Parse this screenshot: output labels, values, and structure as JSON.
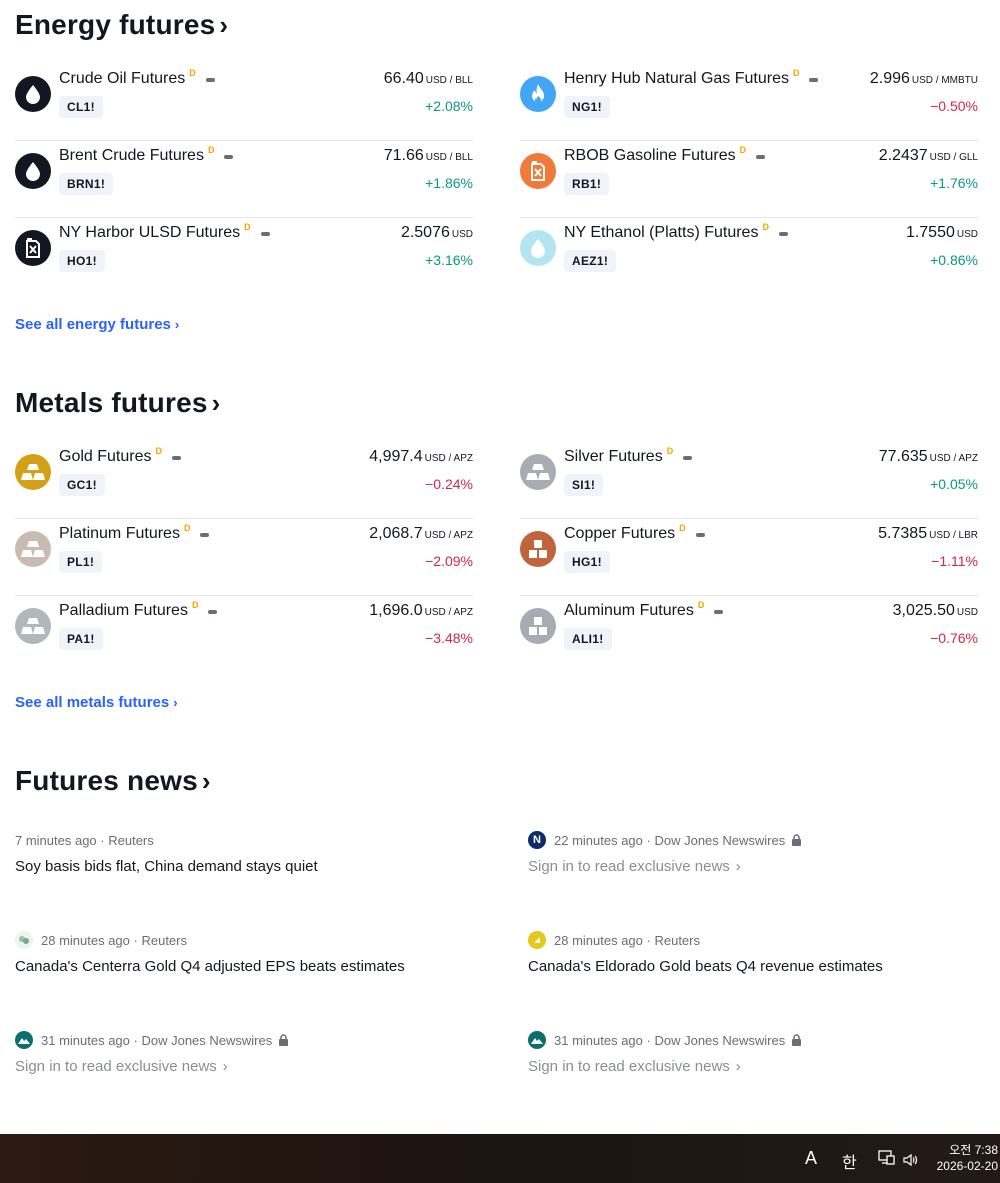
{
  "energy": {
    "title": "Energy futures",
    "see_all": "See all energy futures",
    "items": [
      {
        "name": "Crude Oil Futures",
        "d": "D",
        "ticker": "CL1!",
        "price": "66.40",
        "unit": "USD / BLL",
        "change": "+2.08%",
        "dir": "up",
        "icon": "oil-drop-icon",
        "color": "#131722"
      },
      {
        "name": "Henry Hub Natural Gas Futures",
        "d": "D",
        "ticker": "NG1!",
        "price": "2.996",
        "unit": "USD / MMBTU",
        "change": "−0.50%",
        "dir": "down",
        "icon": "flame-icon",
        "color": "#42a5f5"
      },
      {
        "name": "Brent Crude Futures",
        "d": "D",
        "ticker": "BRN1!",
        "price": "71.66",
        "unit": "USD / BLL",
        "change": "+1.86%",
        "dir": "up",
        "icon": "oil-drop-icon",
        "color": "#131722"
      },
      {
        "name": "RBOB Gasoline Futures",
        "d": "D",
        "ticker": "RB1!",
        "price": "2.2437",
        "unit": "USD / GLL",
        "change": "+1.76%",
        "dir": "up",
        "icon": "fuel-can-icon",
        "color": "#f07a3a"
      },
      {
        "name": "NY Harbor ULSD Futures",
        "d": "D",
        "ticker": "HO1!",
        "price": "2.5076",
        "unit": "USD",
        "change": "+3.16%",
        "dir": "up",
        "icon": "fuel-can-icon",
        "color": "#131722"
      },
      {
        "name": "NY Ethanol (Platts) Futures",
        "d": "D",
        "ticker": "AEZ1!",
        "price": "1.7550",
        "unit": "USD",
        "change": "+0.86%",
        "dir": "up",
        "icon": "water-drop-icon",
        "color": "#b3e5f0"
      }
    ]
  },
  "metals": {
    "title": "Metals futures",
    "see_all": "See all metals futures",
    "items": [
      {
        "name": "Gold Futures",
        "d": "D",
        "ticker": "GC1!",
        "price": "4,997.4",
        "unit": "USD / APZ",
        "change": "−0.24%",
        "dir": "down",
        "icon": "gold-bars-icon",
        "color": "#d4a017"
      },
      {
        "name": "Silver Futures",
        "d": "D",
        "ticker": "SI1!",
        "price": "77.635",
        "unit": "USD / APZ",
        "change": "+0.05%",
        "dir": "up",
        "icon": "silver-bars-icon",
        "color": "#a9abb3"
      },
      {
        "name": "Platinum Futures",
        "d": "D",
        "ticker": "PL1!",
        "price": "2,068.7",
        "unit": "USD / APZ",
        "change": "−2.09%",
        "dir": "down",
        "icon": "platinum-bars-icon",
        "color": "#c8bcb0"
      },
      {
        "name": "Copper Futures",
        "d": "D",
        "ticker": "HG1!",
        "price": "5.7385",
        "unit": "USD / LBR",
        "change": "−1.11%",
        "dir": "down",
        "icon": "copper-blocks-icon",
        "color": "#c0643c"
      },
      {
        "name": "Palladium Futures",
        "d": "D",
        "ticker": "PA1!",
        "price": "1,696.0",
        "unit": "USD / APZ",
        "change": "−3.48%",
        "dir": "down",
        "icon": "palladium-bars-icon",
        "color": "#b0b8b8"
      },
      {
        "name": "Aluminum Futures",
        "d": "D",
        "ticker": "ALI1!",
        "price": "3,025.50",
        "unit": "USD",
        "change": "−0.76%",
        "dir": "down",
        "icon": "aluminum-blocks-icon",
        "color": "#a9abb3"
      }
    ]
  },
  "news": {
    "title": "Futures news",
    "items": [
      {
        "time": "7 minutes ago",
        "source": "Reuters",
        "headline": "Soy basis bids flat, China demand stays quiet",
        "locked": false,
        "icon": ""
      },
      {
        "time": "22 minutes ago",
        "source": "Dow Jones Newswires",
        "headline": "Sign in to read exclusive news",
        "locked": true,
        "icon": "dow-jones-icon"
      },
      {
        "time": "28 minutes ago",
        "source": "Reuters",
        "headline": "Canada's Centerra Gold Q4 adjusted EPS beats estimates",
        "locked": false,
        "icon": "centerra-icon"
      },
      {
        "time": "28 minutes ago",
        "source": "Reuters",
        "headline": "Canada's Eldorado Gold beats Q4 revenue estimates",
        "locked": false,
        "icon": "eldorado-icon"
      },
      {
        "time": "31 minutes ago",
        "source": "Dow Jones Newswires",
        "headline": "Sign in to read exclusive news",
        "locked": true,
        "icon": "mountain-icon"
      },
      {
        "time": "31 minutes ago",
        "source": "Dow Jones Newswires",
        "headline": "Sign in to read exclusive news",
        "locked": true,
        "icon": "mountain-icon"
      }
    ]
  },
  "taskbar": {
    "ime_a": "A",
    "ime_han": "한",
    "time": "오전 7:38",
    "date": "2026-02-20"
  }
}
